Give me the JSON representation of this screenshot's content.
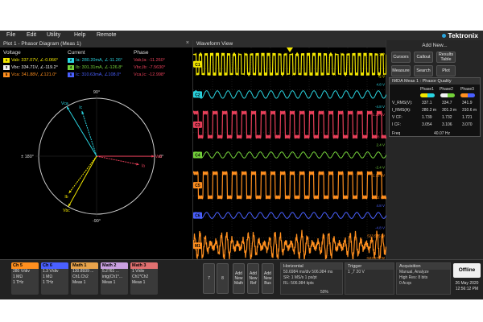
{
  "menu": {
    "items": [
      "File",
      "Edit",
      "Utility",
      "Help",
      "Remote"
    ],
    "brand": "Tektronix"
  },
  "plot": {
    "title": "Plot 1 - Phasor Diagram (Meas 1)",
    "close_icon": "×",
    "headers": {
      "voltage": "Voltage",
      "current": "Current",
      "phase": "Phase"
    },
    "rows": [
      {
        "v_badge": "1",
        "v_text": "Vab: 337.07V, ∠-0.066°",
        "v_color": "#f2e600",
        "i_badge": "2",
        "i_text": "Ia: 280.20mA, ∠-11.26°",
        "i_color": "#2ad4e0",
        "p_text": "Vab,Ia: -11.260°",
        "p_color": "#e8405a"
      },
      {
        "v_badge": "3",
        "v_text": "Vbc: 334.71V, ∠-119.2°",
        "v_color": "#f2f2f2",
        "i_badge": "4",
        "i_text": "Ib: 301.31mA, ∠-126.8°",
        "i_color": "#74d13a",
        "p_text": "Vbc,Ib: -7.5630°",
        "p_color": "#e8405a"
      },
      {
        "v_badge": "5",
        "v_text": "Vca: 341.88V, ∠121.0°",
        "v_color": "#ff8f1f",
        "i_badge": "6",
        "i_text": "Ic: 310.63mA, ∠108.0°",
        "i_color": "#4a60ff",
        "p_text": "Vca,Ic: -12.998°",
        "p_color": "#e8405a"
      }
    ],
    "angle_labels": {
      "top": "90°",
      "bottom": "-90°",
      "left": "± 180°",
      "right": "0°"
    },
    "vector_labels": {
      "vab": "Vab",
      "ia": "Ia",
      "vbc": "Vbc",
      "ib": "Ib",
      "vca": "Vca",
      "ic": "Ic"
    },
    "vectors": [
      {
        "key": "vab",
        "mag": 1.0,
        "angle": -0.066,
        "color": "#e8405a"
      },
      {
        "key": "ia",
        "mag": 0.75,
        "angle": -11.26,
        "color": "#e8405a"
      },
      {
        "key": "vbc",
        "mag": 1.0,
        "angle": -119.2,
        "color": "#f2e600"
      },
      {
        "key": "ib",
        "mag": 0.8,
        "angle": -126.8,
        "color": "#f2e600"
      },
      {
        "key": "vca",
        "mag": 1.0,
        "angle": 121.0,
        "color": "#2ad4e0"
      },
      {
        "key": "ic",
        "mag": 0.82,
        "angle": 108.0,
        "color": "#2ad4e0"
      }
    ]
  },
  "waveform": {
    "title": "Waveform View",
    "traces": [
      {
        "label": "C1",
        "color": "#f2e600",
        "scale_top": "2 V",
        "scale_bot": "-2 V",
        "style": "square",
        "cycles": 34,
        "amp": 0.65
      },
      {
        "label": "C2",
        "color": "#2ad4e0",
        "scale_top": "4.8 V",
        "scale_bot": "-4.8 V",
        "style": "sine",
        "cycles": 18,
        "amp": 0.25
      },
      {
        "label": "C3",
        "color": "#e8405a",
        "scale_top": "1.28 kV",
        "scale_bot": "-1.28 kV",
        "style": "square",
        "cycles": 20,
        "amp": 0.8
      },
      {
        "label": "C4",
        "color": "#74d13a",
        "scale_top": "2.4 V",
        "scale_bot": "-2.4 V",
        "style": "sine",
        "cycles": 18,
        "amp": 0.2
      },
      {
        "label": "C5",
        "color": "#ff8f1f",
        "scale_top": "1.12 kV",
        "scale_bot": "-1.12 kV",
        "style": "square",
        "cycles": 20,
        "amp": 0.8
      },
      {
        "label": "C6",
        "color": "#4a60ff",
        "scale_top": "4.8 V",
        "scale_bot": "-4.8 V",
        "style": "sine",
        "cycles": 18,
        "amp": 0.2
      },
      {
        "label": "M1",
        "color": "#ff8f1f",
        "scale_top": "523.575 W",
        "scale_bot": "-523.575 W",
        "style": "noisy",
        "cycles": 36,
        "amp": 0.85
      }
    ]
  },
  "right": {
    "add_new": "Add New...",
    "buttons": [
      {
        "key": "cursors",
        "label": "Cursors"
      },
      {
        "key": "callout",
        "label": "Callout"
      },
      {
        "key": "results",
        "label": "Results Table"
      },
      {
        "key": "measure",
        "label": "Measure"
      },
      {
        "key": "search",
        "label": "Search"
      },
      {
        "key": "plot",
        "label": "Plot"
      }
    ],
    "meas": {
      "title": "IMDA Meas 1 : Phasor Quality",
      "phases": [
        "Phase1",
        "Phase2",
        "Phase3"
      ],
      "phase_colors": [
        [
          "#f2e600",
          "#2ad4e0"
        ],
        [
          "#f2f2f2",
          "#74d13a"
        ],
        [
          "#ff8f1f",
          "#4a60ff"
        ]
      ],
      "row_labels": [
        "V_RMS(V):",
        "I_RMS(A):",
        "V CF:",
        "I CF:"
      ],
      "values": [
        [
          "337.1",
          "334.7",
          "341.9"
        ],
        [
          "280.2 m",
          "301.3 m",
          "310.6 m"
        ],
        [
          "1.739",
          "1.732",
          "1.721"
        ],
        [
          "3.054",
          "3.106",
          "3.070"
        ]
      ],
      "freq_label": "Freq",
      "freq_value": "40.07 Hz"
    }
  },
  "bottom": {
    "channels": [
      {
        "key": "ch5",
        "head": "Ch 5",
        "color": "#ff8f1f",
        "lines": [
          "280 V/div",
          "1 MΩ",
          "1 THz"
        ]
      },
      {
        "key": "ch6",
        "head": "Ch 6",
        "color": "#4a60ff",
        "lines": [
          "1.3 V/div",
          "1 MΩ",
          "1 THz"
        ]
      },
      {
        "key": "math1",
        "head": "Math 1",
        "color": "#e8a34b",
        "lines": [
          "130.8939 ...",
          "Ch1.Ch2",
          "Meas 1"
        ]
      },
      {
        "key": "math2",
        "head": "Math 2",
        "color": "#c9a0e0",
        "lines": [
          "5.2761 ...",
          "intg(Ch1*...",
          "Meas 1"
        ]
      },
      {
        "key": "math3",
        "head": "Math 3",
        "color": "#e07070",
        "lines": [
          "1 V/div",
          "Ch1*Ch2",
          "Meas 1"
        ]
      }
    ],
    "sq_buttons": [
      {
        "key": "seven",
        "label": "7"
      },
      {
        "key": "eight",
        "label": "8"
      },
      {
        "key": "add-math",
        "label": "Add New Math"
      },
      {
        "key": "add-ref",
        "label": "Add New Ref"
      },
      {
        "key": "add-bus",
        "label": "Add New Bus"
      }
    ],
    "horizontal": {
      "head": "Horizontal",
      "lines": [
        "50.6984 ms/div   506.984 ms",
        "SR: 1 MS/s         1 ps/pt",
        "RL: 506.984 kpts",
        "50%"
      ]
    },
    "trigger": {
      "head": "Trigger",
      "lines": [
        "1  ⤴  20 V"
      ]
    },
    "acquisition": {
      "head": "Acquisition",
      "lines": [
        "Manual,       Analyze",
        "High Res: 8 bits",
        "0 Acqs"
      ]
    },
    "offline": "Offline",
    "date": "26 May 2020",
    "time": "12:56:12 PM"
  }
}
